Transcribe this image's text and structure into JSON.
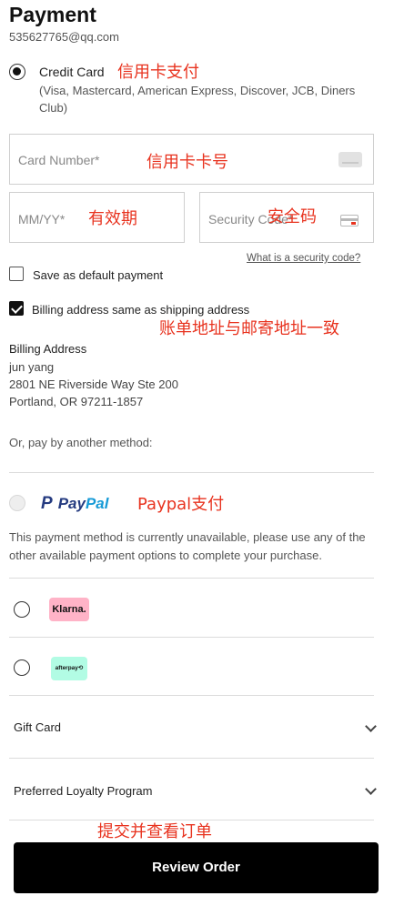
{
  "header": {
    "title": "Payment",
    "email": "535627765@qq.com"
  },
  "credit_card": {
    "label": "Credit Card",
    "annotation": "信用卡支付",
    "brands": "(Visa, Mastercard, American Express, Discover, JCB, Diners Club)",
    "selected": true,
    "card_number": {
      "placeholder": "Card Number*",
      "value": "",
      "annotation": "信用卡卡号",
      "icon": "card-icon"
    },
    "expiry": {
      "placeholder": "MM/YY*",
      "value": "",
      "annotation": "有效期"
    },
    "security_code": {
      "placeholder": "Security Code*",
      "value": "",
      "annotation": "安全码",
      "icon": "card-security-icon"
    },
    "security_link": "What is a security code?"
  },
  "options": {
    "save_default": {
      "label": "Save as default payment",
      "checked": false
    },
    "billing_same": {
      "label": "Billing address same as shipping address",
      "checked": true,
      "annotation": "账单地址与邮寄地址一致"
    }
  },
  "billing_address": {
    "title": "Billing Address",
    "name": "jun yang",
    "line1": "2801 NE Riverside Way Ste 200",
    "line2": "Portland, OR 97211-1857"
  },
  "other_methods": {
    "heading": "Or, pay by another method:",
    "paypal": {
      "logo_pay": "Pay",
      "logo_pal": "Pal",
      "annotation": "Paypal支付",
      "unavailable_note": "This payment method is currently unavailable, please use any of the other available payment options to complete your purchase.",
      "disabled": true
    },
    "klarna": {
      "logo": "Klarna.",
      "color": "#ffb3c7"
    },
    "afterpay": {
      "logo": "afterpay⟲",
      "color": "#b2fce4"
    }
  },
  "accordions": {
    "gift_card": "Gift Card",
    "loyalty": "Preferred Loyalty Program"
  },
  "footer": {
    "annotation": "提交并查看订单",
    "review_button": "Review Order"
  },
  "colors": {
    "annotation": "#e8331f",
    "button_bg": "#000000",
    "paypal_dark": "#253b80",
    "paypal_light": "#179bd7"
  }
}
